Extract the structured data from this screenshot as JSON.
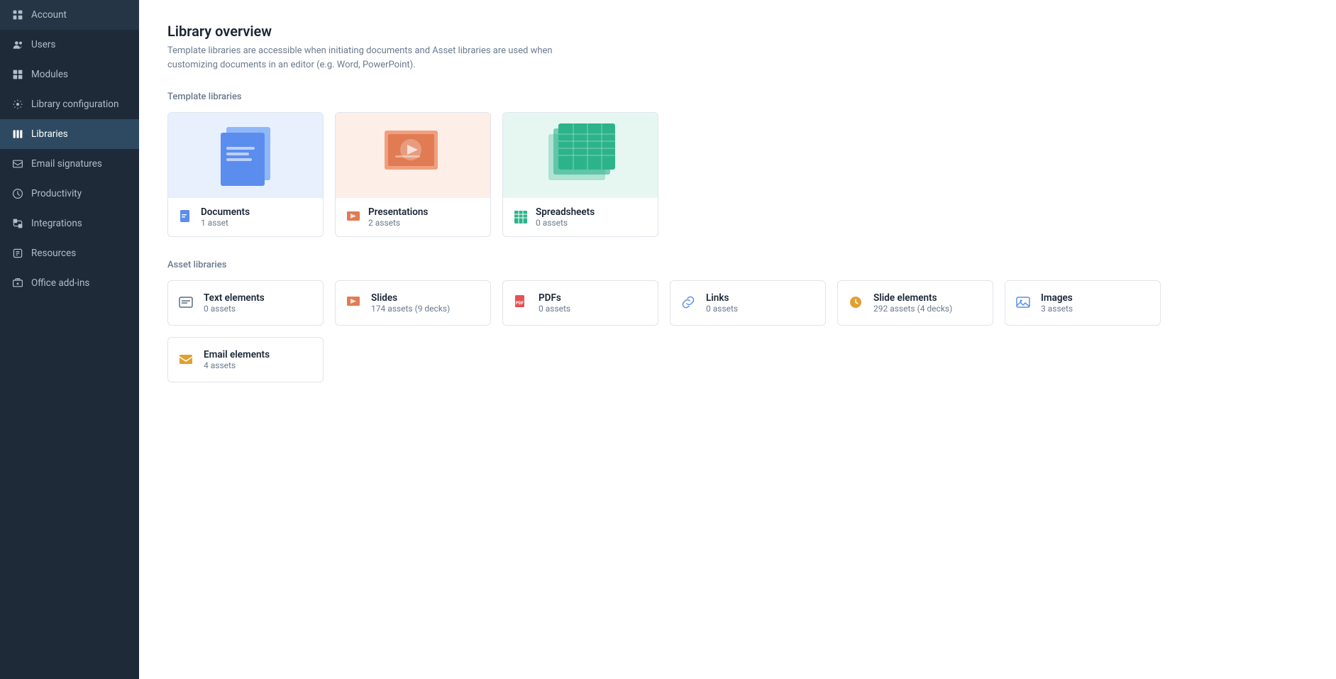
{
  "sidebar": {
    "items": [
      {
        "id": "account",
        "label": "Account",
        "icon": "account-icon",
        "active": false
      },
      {
        "id": "users",
        "label": "Users",
        "icon": "users-icon",
        "active": false
      },
      {
        "id": "modules",
        "label": "Modules",
        "icon": "modules-icon",
        "active": false
      },
      {
        "id": "library-configuration",
        "label": "Library configuration",
        "icon": "config-icon",
        "active": false
      },
      {
        "id": "libraries",
        "label": "Libraries",
        "icon": "libraries-icon",
        "active": true
      },
      {
        "id": "email-signatures",
        "label": "Email signatures",
        "icon": "email-sig-icon",
        "active": false
      },
      {
        "id": "productivity",
        "label": "Productivity",
        "icon": "productivity-icon",
        "active": false
      },
      {
        "id": "integrations",
        "label": "Integrations",
        "icon": "integrations-icon",
        "active": false
      },
      {
        "id": "resources",
        "label": "Resources",
        "icon": "resources-icon",
        "active": false
      },
      {
        "id": "office-add-ins",
        "label": "Office add-ins",
        "icon": "office-icon",
        "active": false
      }
    ]
  },
  "main": {
    "page_title": "Library overview",
    "page_description": "Template libraries are accessible when initiating documents and Asset libraries are used when customizing documents in an editor (e.g. Word, PowerPoint).",
    "template_section_title": "Template libraries",
    "asset_section_title": "Asset libraries",
    "template_libraries": [
      {
        "id": "documents",
        "name": "Documents",
        "count": "1 asset",
        "icon_color": "#5b8dee",
        "bg_color": "#e8f0fe"
      },
      {
        "id": "presentations",
        "name": "Presentations",
        "count": "2 assets",
        "icon_color": "#e07b54",
        "bg_color": "#fdeee8"
      },
      {
        "id": "spreadsheets",
        "name": "Spreadsheets",
        "count": "0 assets",
        "icon_color": "#2db38a",
        "bg_color": "#e6f7f2"
      }
    ],
    "asset_libraries": [
      {
        "id": "text-elements",
        "name": "Text elements",
        "count": "0 assets",
        "icon_color": "#5b6b7d"
      },
      {
        "id": "slides",
        "name": "Slides",
        "count": "174 assets (9 decks)",
        "icon_color": "#e07b54"
      },
      {
        "id": "pdfs",
        "name": "PDFs",
        "count": "0 assets",
        "icon_color": "#e05454"
      },
      {
        "id": "links",
        "name": "Links",
        "count": "0 assets",
        "icon_color": "#5b8dee"
      },
      {
        "id": "slide-elements",
        "name": "Slide elements",
        "count": "292 assets (4 decks)",
        "icon_color": "#e0a030"
      },
      {
        "id": "images",
        "name": "Images",
        "count": "3 assets",
        "icon_color": "#5b8dee"
      },
      {
        "id": "email-elements",
        "name": "Email elements",
        "count": "4 assets",
        "icon_color": "#e0a030"
      }
    ]
  }
}
